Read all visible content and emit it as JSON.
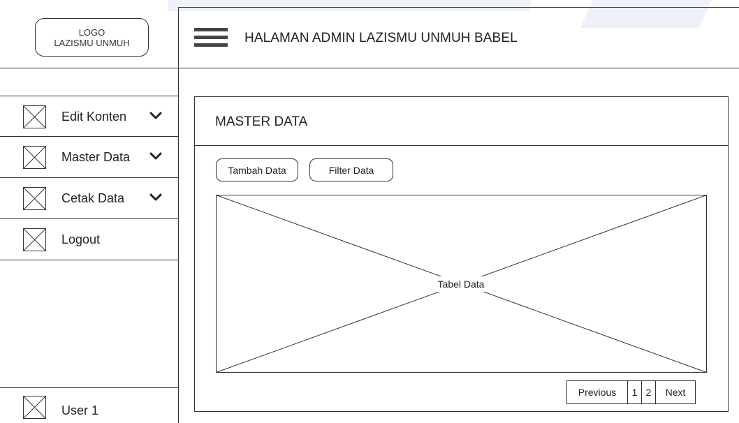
{
  "logo": {
    "line1": "LOGO",
    "line2": "LAZISMU UNMUH"
  },
  "header": {
    "title": "HALAMAN ADMIN LAZISMU UNMUH BABEL",
    "menu_icon": "hamburger-icon"
  },
  "sidebar": {
    "items": [
      {
        "label": "Edit Konten",
        "icon": "image-placeholder-icon",
        "has_dropdown": true
      },
      {
        "label": "Master Data",
        "icon": "image-placeholder-icon",
        "has_dropdown": true
      },
      {
        "label": "Cetak Data",
        "icon": "image-placeholder-icon",
        "has_dropdown": true
      },
      {
        "label": "Logout",
        "icon": "image-placeholder-icon",
        "has_dropdown": false
      }
    ],
    "user": {
      "label": "User 1",
      "icon": "image-placeholder-icon"
    }
  },
  "main": {
    "title": "MASTER DATA",
    "buttons": {
      "add": "Tambah Data",
      "filter": "Filter Data"
    },
    "table_placeholder": "Tabel Data",
    "pagination": {
      "previous": "Previous",
      "pages": [
        "1",
        "2"
      ],
      "next": "Next"
    }
  },
  "colors": {
    "line": "#333333",
    "background": "#ffffff",
    "decor": "#eef1f8"
  }
}
